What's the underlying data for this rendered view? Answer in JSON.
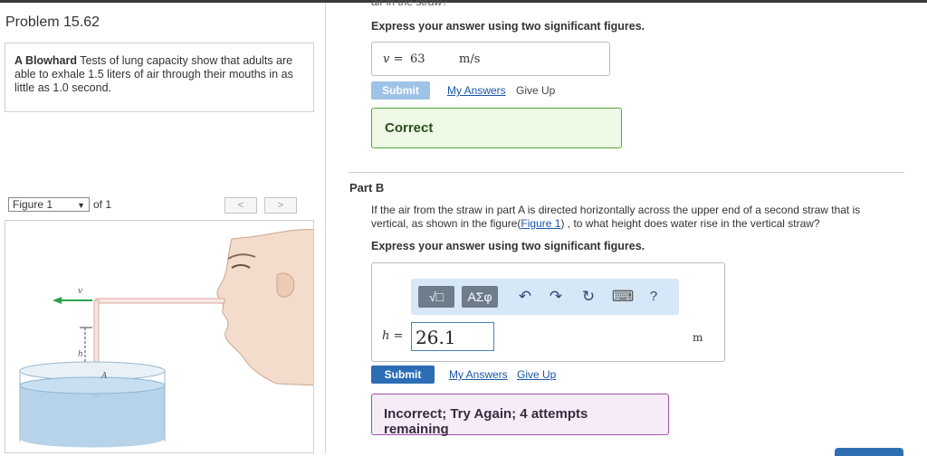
{
  "problem": {
    "title": "Problem 15.62",
    "intro_bold": "A Blowhard",
    "intro_text": "Tests of lung capacity show that adults are able to exhale 1.5 liters of air through their mouths in as little as 1.0 second."
  },
  "figure_nav": {
    "selected": "Figure 1",
    "of_label": "of 1",
    "prev": "<",
    "next": ">"
  },
  "figure": {
    "v_label": "v",
    "h_label": "h",
    "a_label": "A"
  },
  "part_a": {
    "cut_text": "air in the straw?",
    "instruction": "Express your answer using two significant figures.",
    "var": "v =",
    "value": "63",
    "unit": "m/s",
    "submit": "Submit",
    "my_answers": "My Answers",
    "give_up": "Give Up",
    "result": "Correct"
  },
  "part_b": {
    "label": "Part B",
    "question_pre": "If the air from the straw in part A is directed horizontally across the upper end of a second straw that is vertical, as shown in the figure(",
    "question_link": "Figure 1",
    "question_post": ") , to what height does water rise in the vertical straw?",
    "instruction": "Express your answer using two significant figures.",
    "toolbar": {
      "templates": "√□",
      "greek": "ΑΣφ",
      "undo": "↶",
      "redo": "↷",
      "reset": "↻",
      "keyboard": "⌨",
      "help": "?"
    },
    "var": "h =",
    "value": "26.1",
    "unit": "m",
    "submit": "Submit",
    "my_answers": "My Answers",
    "give_up": "Give Up",
    "result": "Incorrect; Try Again; 4 attempts remaining"
  },
  "colors": {
    "submit_disabled": "#9dc3e6",
    "submit_active": "#2d6db5",
    "correct_border": "#58a83b",
    "incorrect_border": "#a24fae",
    "link": "#1a55a8"
  }
}
